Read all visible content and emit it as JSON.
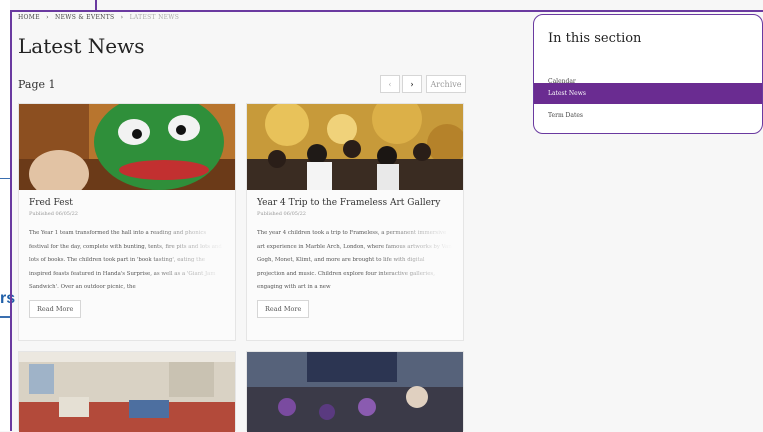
{
  "breadcrumb": {
    "home": "HOME",
    "sep1": "›",
    "section": "NEWS & EVENTS",
    "sep2": "›",
    "current": "LATEST NEWS"
  },
  "page": {
    "title": "Latest News",
    "page_label": "Page 1"
  },
  "pager": {
    "prev": "‹",
    "next": "›",
    "archive": "Archive"
  },
  "cards": [
    {
      "title": "Fred Fest",
      "date": "Published 06/05/22",
      "excerpt": "The Year 1 team transformed the hall into a reading and phonics festival for the day, complete with bunting, tents, fire pits and lots and lots of books. The children took part in 'book tasting', eating the inspired feasts featured in Handa's Surprise, as well as a 'Giant Jam Sandwich'. Over an outdoor picnic, the",
      "read_more": "Read More"
    },
    {
      "title": "Year 4 Trip to the Frameless Art Gallery",
      "date": "Published 06/05/22",
      "excerpt": "The year 4 children took a trip to Frameless, a permanent immersive art experience in Marble Arch, London, where famous artworks by Van Gogh, Monet, Klimt, and more are brought to life with digital projection and music. Children explore four interactive galleries, engaging with art in a new",
      "read_more": "Read More"
    }
  ],
  "sidebar": {
    "heading": "In this section",
    "items": [
      "Calendar",
      "Latest News",
      "Term Dates"
    ]
  },
  "outside": {
    "fragment": "rs"
  },
  "colors": {
    "accent": "#6a2c91",
    "frame": "#6a3aa0"
  }
}
